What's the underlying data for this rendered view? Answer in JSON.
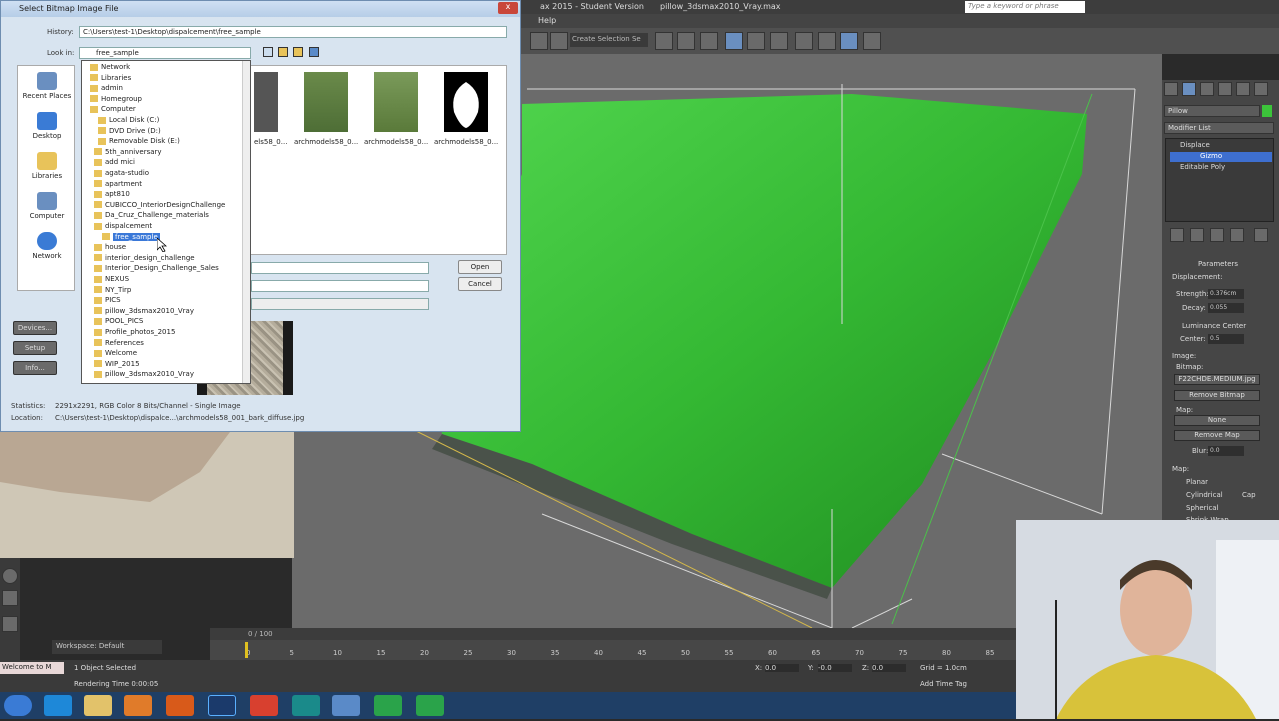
{
  "dialog": {
    "title": "Select Bitmap Image File",
    "history_label": "History:",
    "history_value": "C:\\Users\\test-1\\Desktop\\dispalcement\\free_sample",
    "lookin_label": "Look in:",
    "lookin_value": "free_sample",
    "places": [
      "Recent Places",
      "Desktop",
      "Libraries",
      "Computer",
      "Network"
    ],
    "thumbs": [
      "els58_0...",
      "archmodels58_0...",
      "archmodels58_0...",
      "archmodels58_0..."
    ],
    "dropdown": [
      "Network",
      "Libraries",
      "admin",
      "Homegroup",
      "Computer",
      "Local Disk (C:)",
      "DVD Drive (D:)",
      "Removable Disk (E:)",
      "5th_anniversary",
      "add mici",
      "agata-studio",
      "apartment",
      "apt810",
      "CUBICCO_InteriorDesignChallenge",
      "Da_Cruz_Challenge_materials",
      "dispalcement",
      "free_sample",
      "house",
      "interior_design_challenge",
      "Interior_Design_Challenge_Sales",
      "NEXUS",
      "NY_Tirp",
      "PICS",
      "pillow_3dsmax2010_Vray",
      "POOL_PICS",
      "Profile_photos_2015",
      "References",
      "Welcome",
      "WIP_2015",
      "pillow_3dsmax2010_Vray"
    ],
    "open_label": "Open",
    "cancel_label": "Cancel",
    "side_buttons": [
      "Devices...",
      "Setup",
      "Info..."
    ],
    "stats_label": "Statistics:",
    "stats_value": "2291x2291, RGB Color 8 Bits/Channel - Single Image",
    "location_label": "Location:",
    "location_value": "C:\\Users\\test-1\\Desktop\\dispalce...\\archmodels58_001_bark_diffuse.jpg",
    "close": "x"
  },
  "max": {
    "title_a": "ax 2015 - Student Version",
    "title_b": "pillow_3dsmax2010_Vray.max",
    "search_placeholder": "Type a keyword or phrase",
    "menu_help": "Help",
    "selection_set": "Create Selection Se"
  },
  "command_panel": {
    "object_name": "Pillow",
    "modifier_list": "Modifier List",
    "stack": [
      "Displace",
      "Gizmo",
      "Editable Poly"
    ],
    "parameters": "Parameters",
    "displacement": "Displacement:",
    "strength_label": "Strength:",
    "strength_value": "0.376cm",
    "decay_label": "Decay:",
    "decay_value": "0.055",
    "luminance": "Luminance Center",
    "center_label": "Center:",
    "center_value": "0.5",
    "image_label": "Image:",
    "bitmap_label": "Bitmap:",
    "bitmap_value": "F22CHDE.MEDIUM.jpg",
    "remove_bitmap": "Remove Bitmap",
    "map_label": "Map:",
    "map_value": "None",
    "remove_map": "Remove Map",
    "blur_label": "Blur:",
    "blur_value": "0.0",
    "map2_label": "Map:",
    "planar": "Planar",
    "cylindrical": "Cylindrical",
    "cap": "Cap",
    "spherical": "Spherical",
    "shrink": "Shrink Wrap"
  },
  "timeline": {
    "frame": "0 / 100",
    "ticks": [
      "0",
      "5",
      "10",
      "15",
      "20",
      "25",
      "30",
      "35",
      "40",
      "45",
      "50",
      "55",
      "60",
      "65",
      "70",
      "75",
      "80",
      "85"
    ]
  },
  "status": {
    "workspace": "Workspace: Default",
    "selected": "1 Object Selected",
    "render_time": "Rendering Time 0:00:05",
    "welcome": "Welcome to M",
    "x_label": "X:",
    "x_value": "0.0",
    "y_label": "Y:",
    "y_value": "-0.0",
    "z_label": "Z:",
    "z_value": "0.0",
    "grid": "Grid = 1.0cm",
    "add_time_tag": "Add Time Tag"
  },
  "colors": {
    "pillow": "#3cc43a",
    "viewport": "#6b6b6b",
    "taskbar": "#1f3f66"
  }
}
